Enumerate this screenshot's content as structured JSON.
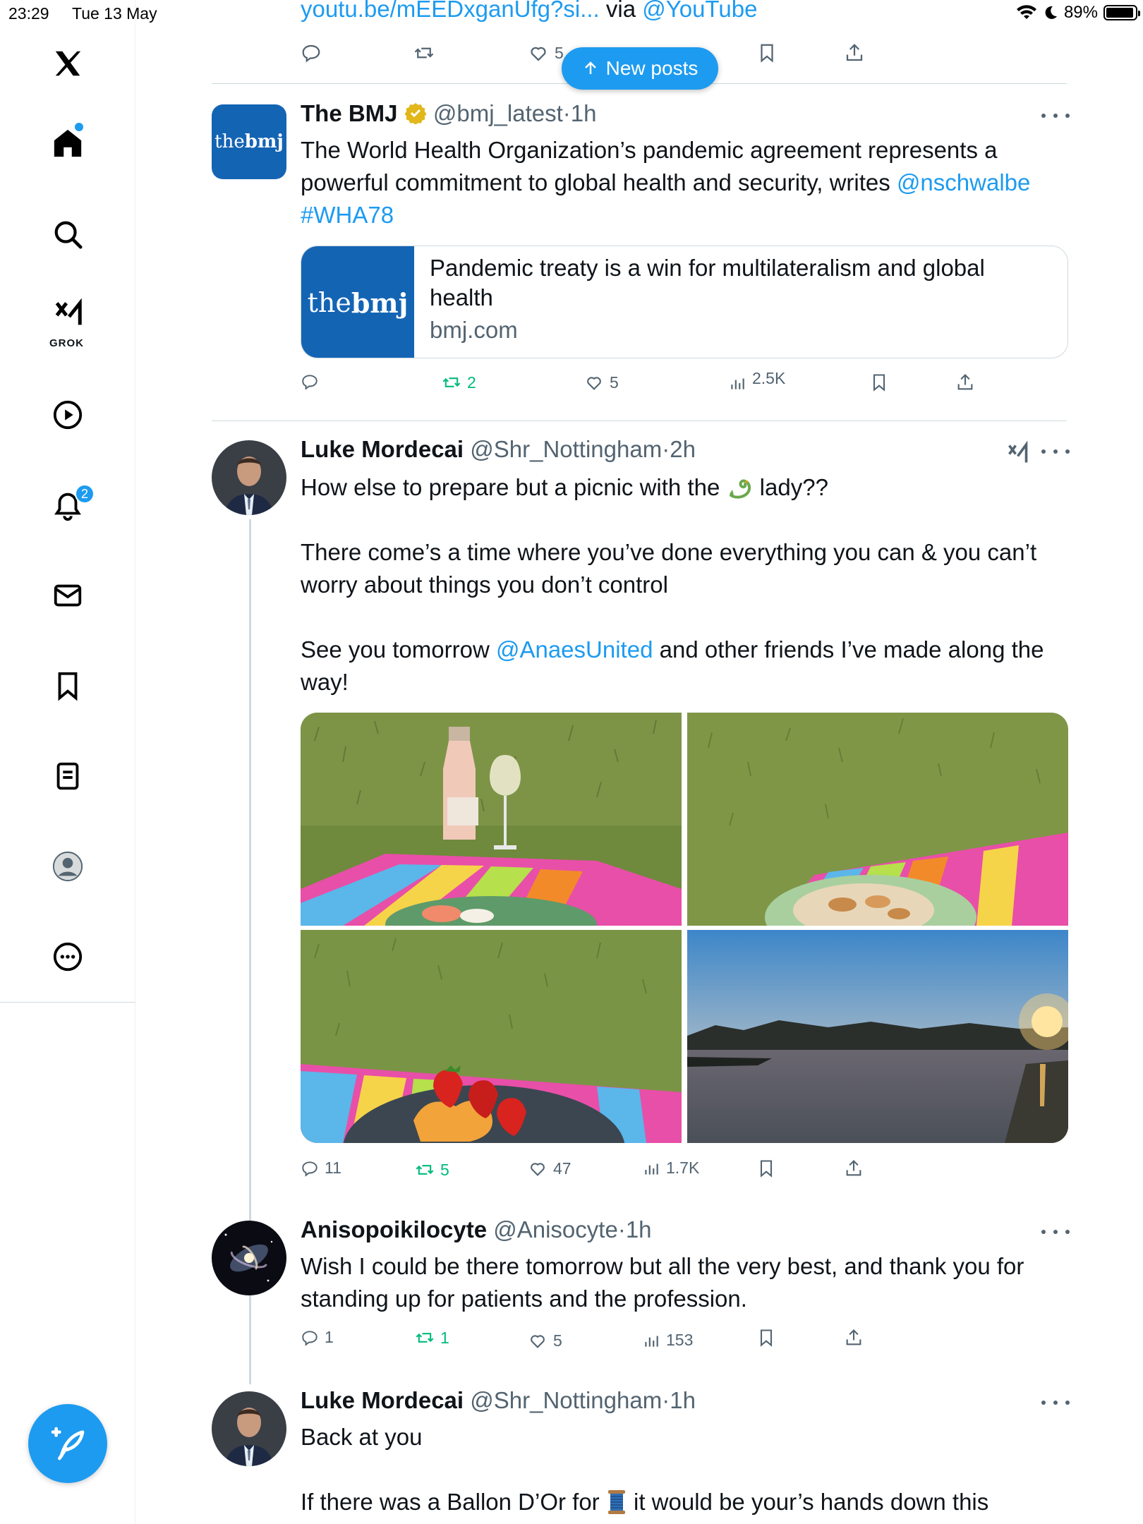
{
  "status_bar": {
    "time": "23:29",
    "date": "Tue 13 May",
    "battery": "89%"
  },
  "sidebar": {
    "items": [
      {
        "name": "x-logo-icon"
      },
      {
        "name": "home-icon"
      },
      {
        "name": "search-icon"
      },
      {
        "name": "grok-icon",
        "label": "GROK"
      },
      {
        "name": "video-icon"
      },
      {
        "name": "notifications-icon",
        "badge": "2"
      },
      {
        "name": "messages-icon"
      },
      {
        "name": "bookmarks-icon"
      },
      {
        "name": "lists-icon"
      },
      {
        "name": "profile-icon"
      },
      {
        "name": "more-icon"
      }
    ],
    "compose_icon": "compose-icon"
  },
  "new_posts": {
    "label": "New posts"
  },
  "top_tweet": {
    "link_text": "youtu.be/mEEDxganUfg?si...",
    "via": "via",
    "via_handle": "@YouTube",
    "likes_partial": "5"
  },
  "tweets": [
    {
      "author": "The BMJ",
      "handle": "@bmj_latest",
      "time": "1h",
      "text_main": "The World Health Organization’s pandemic agreement represents a powerful commitment to global health and security, writes",
      "mention": "@nschwalbe",
      "hashtag": "#WHA78",
      "logo_text_thin": "the",
      "logo_text_bold": "bmj",
      "card": {
        "title": "Pandemic treaty is a win for multilateralism and global health",
        "domain": "bmj.com"
      },
      "stats": {
        "replies": "",
        "reposts": "2",
        "likes": "5",
        "views": "2.5K"
      }
    },
    {
      "author": "Luke Mordecai",
      "handle": "@Shr_Nottingham",
      "time": "2h",
      "line1": "How else to prepare but a picnic with the",
      "line1_end": "lady??",
      "para2": "There come’s a time where you’ve done everything you can & you can’t worry about things you don’t control",
      "para3_start": "See you tomorrow",
      "para3_mention": "@AnaesUnited",
      "para3_end": "and other friends I’ve made along the way!",
      "stats": {
        "replies": "11",
        "reposts": "5",
        "likes": "47",
        "views": "1.7K"
      }
    },
    {
      "author": "Anisopoikilocyte",
      "handle": "@Anisocyte",
      "time": "1h",
      "text": "Wish I could be there tomorrow but all the very best, and thank you for standing up for patients and the profession.",
      "stats": {
        "replies": "1",
        "reposts": "1",
        "likes": "5",
        "views": "153"
      }
    },
    {
      "author": "Luke Mordecai",
      "handle": "@Shr_Nottingham",
      "time": "1h",
      "line1": "Back at you",
      "line2_start": "If there was a Ballon D’Or for",
      "line2_end": "it would be your’s hands down this"
    }
  ],
  "colors": {
    "accent": "#1d9bf0",
    "text": "#0f1419",
    "muted": "#536471",
    "repost_green": "#00ba7c",
    "bmj_blue": "#1464b4"
  }
}
